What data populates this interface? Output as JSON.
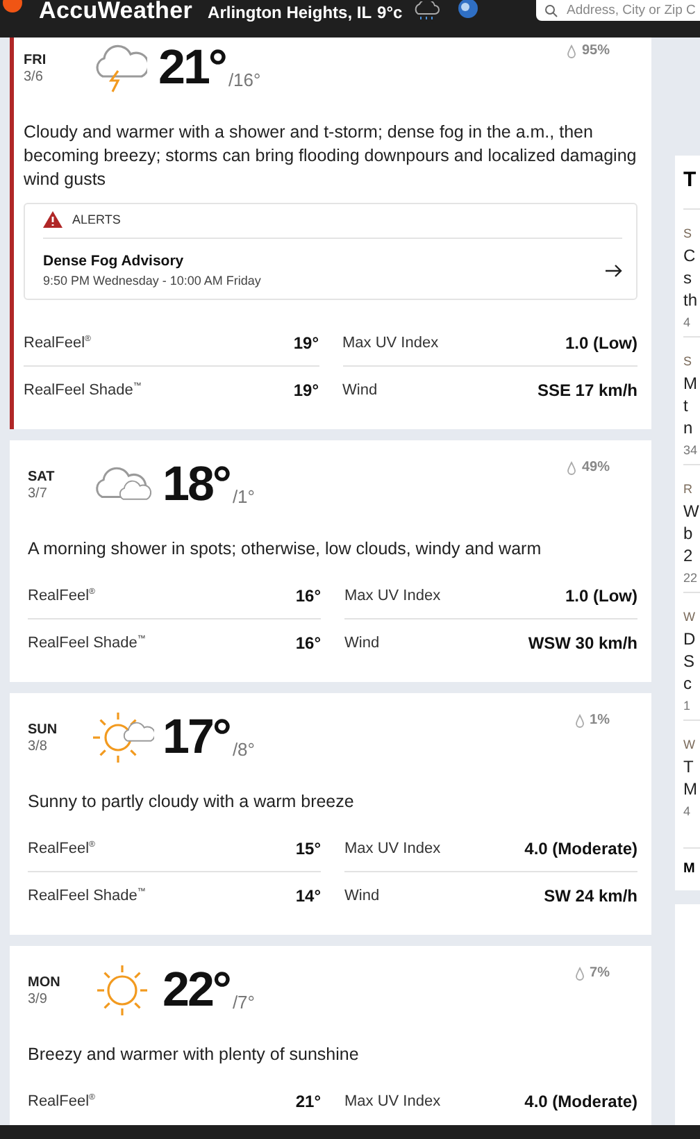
{
  "header": {
    "brand": "AccuWeather",
    "location": "Arlington Heights, IL",
    "temperature": "9°c",
    "search": {
      "placeholder": "Address, City or Zip C"
    }
  },
  "days": [
    {
      "day": "FRI",
      "date": "3/6",
      "kind": "thunderstorm",
      "high": "21°",
      "low": "/16°",
      "precipitation": "95%",
      "highlighted": true,
      "summary": "Cloudy and warmer with a shower and t-storm; dense fog in the a.m., then becoming breezy; storms can bring flooding downpours and localized damaging wind gusts",
      "alert": {
        "heading": "ALERTS",
        "name": "Dense Fog Advisory",
        "time": "9:50 PM Wednesday - 10:00 AM Friday"
      },
      "details": [
        {
          "label": "RealFeel$^{®}$",
          "value": "19°"
        },
        {
          "label": "Max UV Index",
          "value": "1.0 (Low)"
        },
        {
          "label": "RealFeel Shade$^{™}$",
          "value": "19°"
        },
        {
          "label": "Wind",
          "value": "SSE 17 km/h"
        }
      ]
    },
    {
      "day": "SAT",
      "date": "3/7",
      "kind": "cloudy",
      "high": "18°",
      "low": "/1°",
      "precipitation": "49%",
      "highlighted": false,
      "summary": "A morning shower in spots; otherwise, low clouds, windy and warm",
      "details": [
        {
          "label": "RealFeel$^{®}$",
          "value": "16°"
        },
        {
          "label": "Max UV Index",
          "value": "1.0 (Low)"
        },
        {
          "label": "RealFeel Shade$^{™}$",
          "value": "16°"
        },
        {
          "label": "Wind",
          "value": "WSW 30 km/h"
        }
      ]
    },
    {
      "day": "SUN",
      "date": "3/8",
      "kind": "partly-sunny",
      "high": "17°",
      "low": "/8°",
      "precipitation": "1%",
      "highlighted": false,
      "summary": "Sunny to partly cloudy with a warm breeze",
      "details": [
        {
          "label": "RealFeel$^{®}$",
          "value": "15°"
        },
        {
          "label": "Max UV Index",
          "value": "4.0 (Moderate)"
        },
        {
          "label": "RealFeel Shade$^{™}$",
          "value": "14°"
        },
        {
          "label": "Wind",
          "value": "SW 24 km/h"
        }
      ]
    },
    {
      "day": "MON",
      "date": "3/9",
      "kind": "sunny",
      "high": "22°",
      "low": "/7°",
      "precipitation": "7%",
      "highlighted": false,
      "summary": "Breezy and warmer with plenty of sunshine",
      "details": [
        {
          "label": "RealFeel$^{®}$",
          "value": "21°"
        },
        {
          "label": "Max UV Index",
          "value": "4.0 (Moderate)"
        }
      ]
    }
  ],
  "sidebar": {
    "heading": "T",
    "articles": [
      {
        "category": "S",
        "lines": [
          "C",
          "s",
          "th"
        ],
        "time": "4"
      },
      {
        "category": "S",
        "lines": [
          "M",
          "t",
          "n"
        ],
        "time": "34"
      },
      {
        "category": "R",
        "lines": [
          "W",
          "b",
          "2"
        ],
        "time": "22"
      },
      {
        "category": "W",
        "lines": [
          "D",
          "S",
          "c"
        ],
        "time": "1"
      },
      {
        "category": "W",
        "lines": [
          "T",
          "M"
        ],
        "time": "4"
      }
    ],
    "footer": "M"
  }
}
